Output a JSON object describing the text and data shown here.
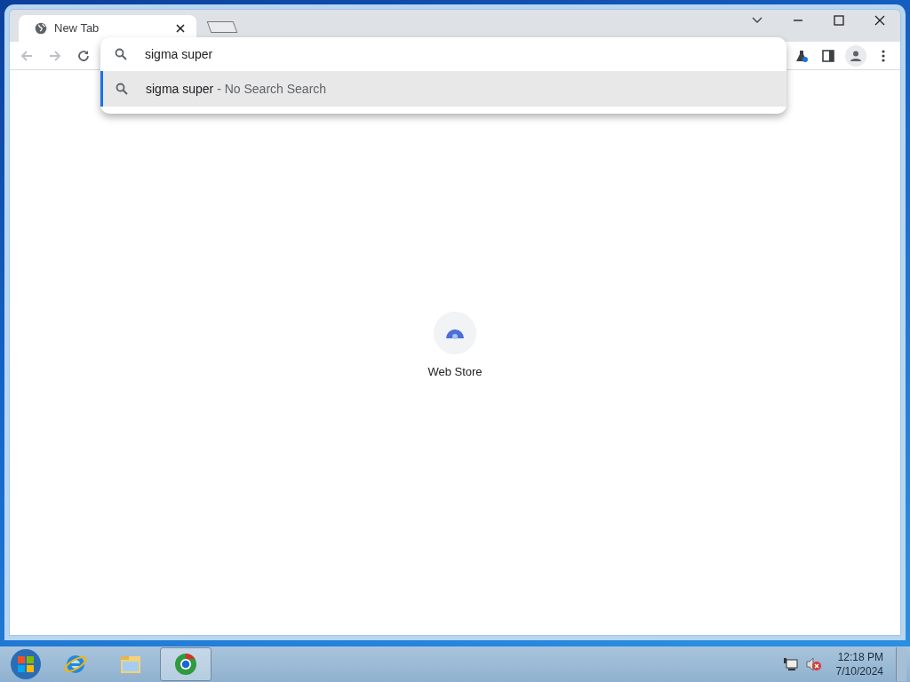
{
  "tabs": [
    {
      "title": "New Tab",
      "selected": true
    }
  ],
  "omnibox": {
    "value": "sigma super"
  },
  "suggestions": [
    {
      "query": "sigma super",
      "description": " - No Search Search",
      "selected": true
    }
  ],
  "shortcuts": [
    {
      "label": "Web Store"
    }
  ],
  "taskbar": {
    "apps": [
      {
        "kind": "ie",
        "selected": false
      },
      {
        "kind": "explorer",
        "selected": false
      },
      {
        "kind": "chrome",
        "selected": true
      }
    ],
    "time": "12:18 PM",
    "date": "7/10/2024"
  }
}
